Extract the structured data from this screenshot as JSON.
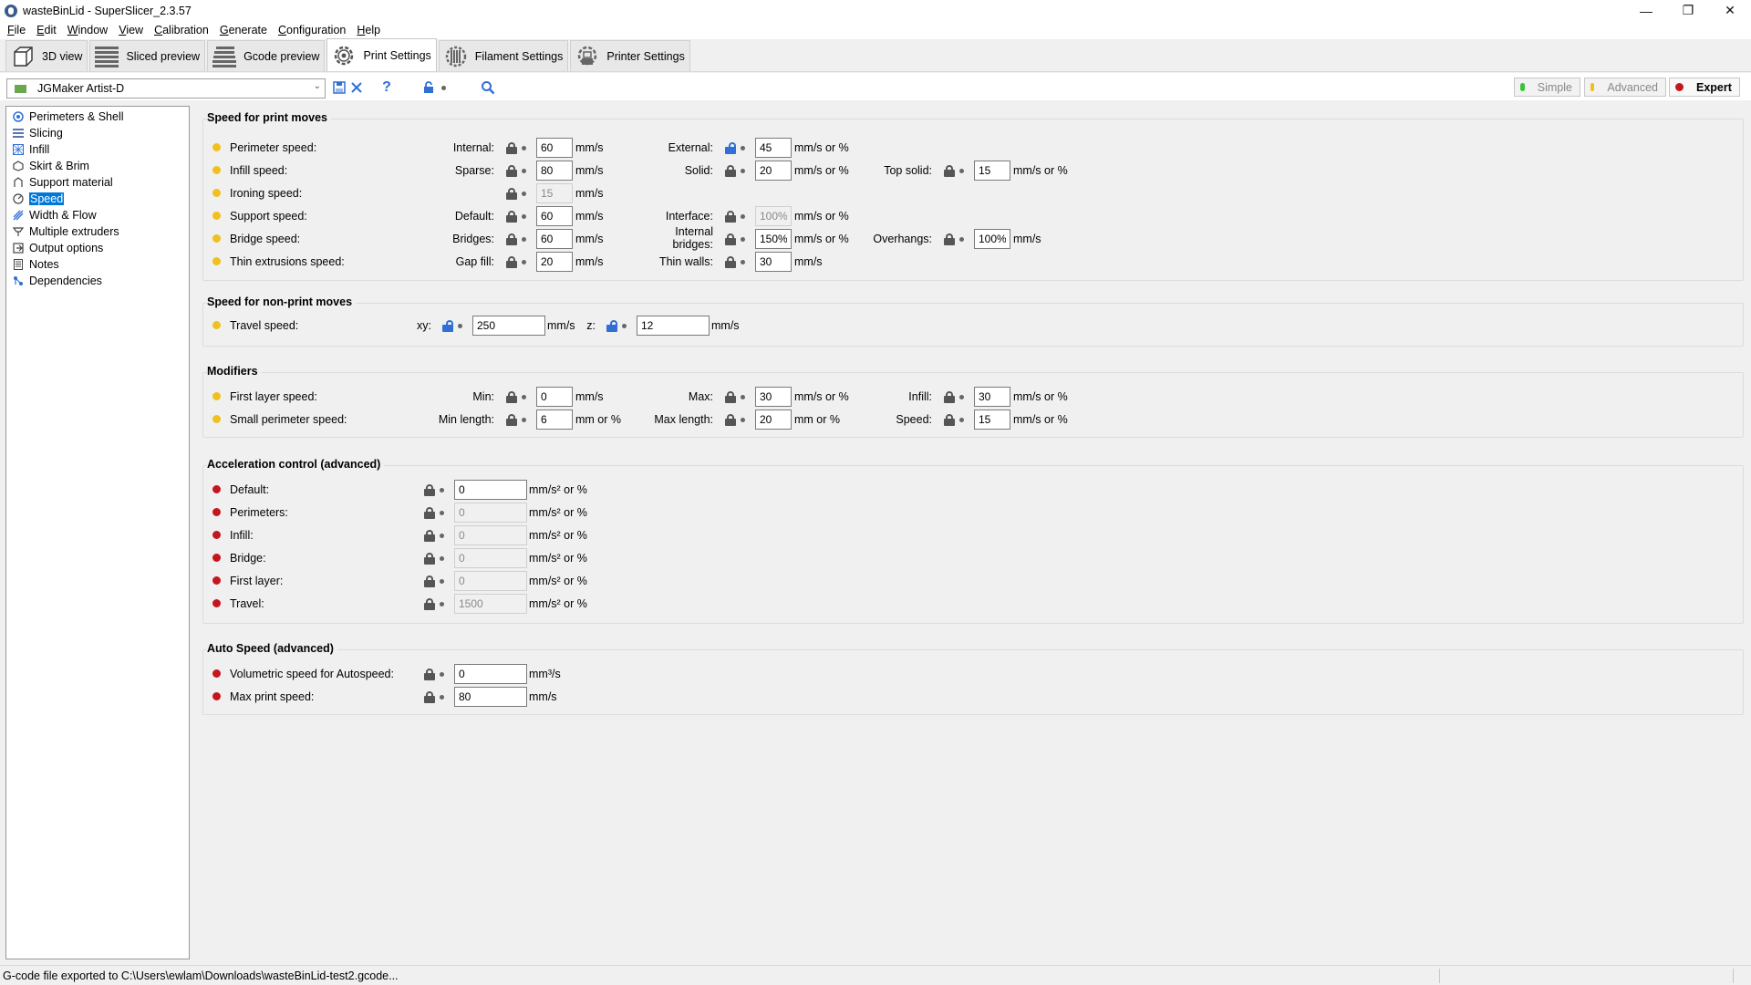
{
  "window": {
    "title": "wasteBinLid - SuperSlicer_2.3.57"
  },
  "menu": [
    "File",
    "Edit",
    "Window",
    "View",
    "Calibration",
    "Generate",
    "Configuration",
    "Help"
  ],
  "tabs": [
    {
      "label": "3D view",
      "icon": "cube-icon"
    },
    {
      "label": "Sliced preview",
      "icon": "layers-icon"
    },
    {
      "label": "Gcode preview",
      "icon": "gcode-layers-icon"
    },
    {
      "label": "Print Settings",
      "icon": "gear-icon",
      "active": true
    },
    {
      "label": "Filament Settings",
      "icon": "filament-spool-icon"
    },
    {
      "label": "Printer Settings",
      "icon": "printer-gear-icon"
    }
  ],
  "preset": {
    "name": "JGMaker Artist-D"
  },
  "modes": {
    "simple": "Simple",
    "advanced": "Advanced",
    "expert": "Expert"
  },
  "colors": {
    "simple": "#3ac23a",
    "advanced": "#f0c020",
    "expert": "#c4161c",
    "selection": "#0078d7"
  },
  "sidebar": [
    {
      "label": "Perimeters & Shell",
      "icon": "perimeters-icon"
    },
    {
      "label": "Slicing",
      "icon": "slicing-icon"
    },
    {
      "label": "Infill",
      "icon": "infill-icon"
    },
    {
      "label": "Skirt & Brim",
      "icon": "skirt-icon"
    },
    {
      "label": "Support material",
      "icon": "support-icon"
    },
    {
      "label": "Speed",
      "icon": "speed-icon",
      "selected": true
    },
    {
      "label": "Width & Flow",
      "icon": "width-flow-icon"
    },
    {
      "label": "Multiple extruders",
      "icon": "extruders-icon"
    },
    {
      "label": "Output options",
      "icon": "output-icon"
    },
    {
      "label": "Notes",
      "icon": "notes-icon"
    },
    {
      "label": "Dependencies",
      "icon": "dependencies-icon"
    }
  ],
  "speed_print": {
    "title": "Speed for print moves",
    "perimeter": {
      "label": "Perimeter speed:",
      "internal_label": "Internal:",
      "internal": "60",
      "internal_unit": "mm/s",
      "external_label": "External:",
      "external": "45",
      "external_unit": "mm/s or %"
    },
    "infill": {
      "label": "Infill speed:",
      "sparse_label": "Sparse:",
      "sparse": "80",
      "sparse_unit": "mm/s",
      "solid_label": "Solid:",
      "solid": "20",
      "solid_unit": "mm/s or %",
      "top_label": "Top solid:",
      "top": "15",
      "top_unit": "mm/s or %"
    },
    "ironing": {
      "label": "Ironing speed:",
      "value": "15",
      "unit": "mm/s"
    },
    "support": {
      "label": "Support speed:",
      "default_label": "Default:",
      "default": "60",
      "default_unit": "mm/s",
      "interface_label": "Interface:",
      "interface": "100%",
      "interface_unit": "mm/s or %"
    },
    "bridge": {
      "label": "Bridge speed:",
      "bridges_label": "Bridges:",
      "bridges": "60",
      "bridges_unit": "mm/s",
      "internal_line1": "Internal",
      "internal_line2": "bridges:",
      "internal": "150%",
      "internal_unit": "mm/s or %",
      "overhangs_label": "Overhangs:",
      "overhangs": "100%",
      "overhangs_unit": "mm/s"
    },
    "thin": {
      "label": "Thin extrusions speed:",
      "gap_label": "Gap fill:",
      "gap": "20",
      "gap_unit": "mm/s",
      "walls_label": "Thin walls:",
      "walls": "30",
      "walls_unit": "mm/s"
    }
  },
  "speed_nonprint": {
    "title": "Speed for non-print moves",
    "travel": {
      "label": "Travel speed:",
      "xy_label": "xy:",
      "xy": "250",
      "xy_unit": "mm/s",
      "z_label": "z:",
      "z": "12",
      "z_unit": "mm/s"
    }
  },
  "modifiers": {
    "title": "Modifiers",
    "first_layer": {
      "label": "First layer speed:",
      "min_label": "Min:",
      "min": "0",
      "min_unit": "mm/s",
      "max_label": "Max:",
      "max": "30",
      "max_unit": "mm/s or %",
      "infill_label": "Infill:",
      "infill": "30",
      "infill_unit": "mm/s or %"
    },
    "small_perim": {
      "label": "Small perimeter speed:",
      "minlen_label": "Min length:",
      "minlen": "6",
      "minlen_unit": "mm or %",
      "maxlen_label": "Max length:",
      "maxlen": "20",
      "maxlen_unit": "mm or %",
      "speed_label": "Speed:",
      "speed": "15",
      "speed_unit": "mm/s or %"
    }
  },
  "accel": {
    "title": "Acceleration control (advanced)",
    "unit": "mm/s² or %",
    "rows": [
      {
        "label": "Default:",
        "value": "0",
        "enabled": true
      },
      {
        "label": "Perimeters:",
        "value": "0",
        "enabled": false
      },
      {
        "label": "Infill:",
        "value": "0",
        "enabled": false
      },
      {
        "label": "Bridge:",
        "value": "0",
        "enabled": false
      },
      {
        "label": "First layer:",
        "value": "0",
        "enabled": false
      },
      {
        "label": "Travel:",
        "value": "1500",
        "enabled": false
      }
    ]
  },
  "autospeed": {
    "title": "Auto Speed (advanced)",
    "volumetric": {
      "label": "Volumetric speed for Autospeed:",
      "value": "0",
      "unit": "mm³/s"
    },
    "max_print": {
      "label": "Max print speed:",
      "value": "80",
      "unit": "mm/s"
    }
  },
  "status": {
    "text": "G-code file exported to C:\\Users\\ewlam\\Downloads\\wasteBinLid-test2.gcode..."
  }
}
